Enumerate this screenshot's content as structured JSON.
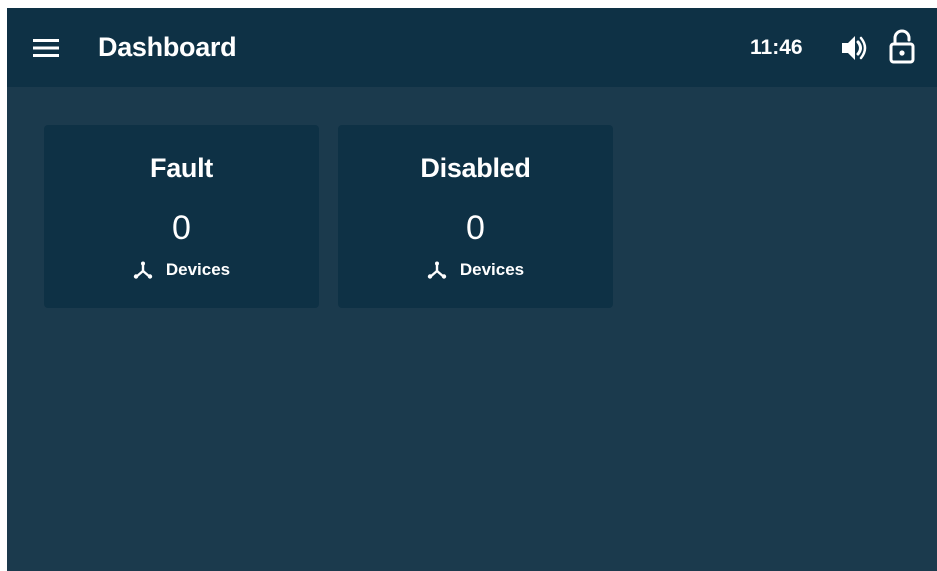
{
  "header": {
    "title": "Dashboard",
    "time": "11:46",
    "menu_icon": "hamburger-menu-icon",
    "sound_icon": "volume-icon",
    "lock_icon": "lock-open-icon"
  },
  "cards": [
    {
      "title": "Fault",
      "count": "0",
      "label": "Devices",
      "icon": "device-hub-icon"
    },
    {
      "title": "Disabled",
      "count": "0",
      "label": "Devices",
      "icon": "device-hub-icon"
    }
  ],
  "colors": {
    "background": "#1b3a4d",
    "header": "#0e3145",
    "card": "#0e3145",
    "text": "#ffffff"
  }
}
